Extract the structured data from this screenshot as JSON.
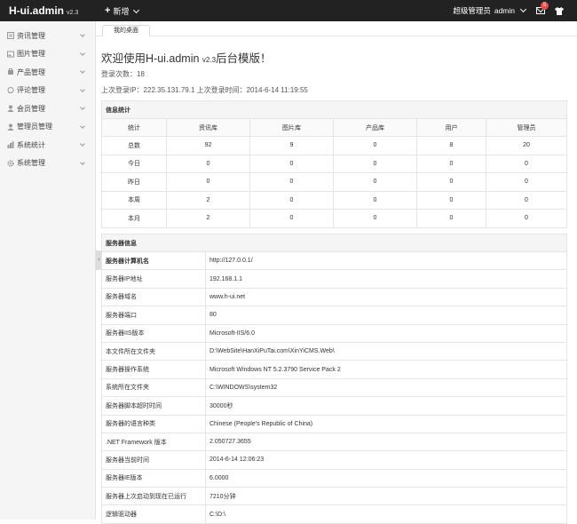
{
  "header": {
    "logo": "H-ui.admin",
    "version": "v2.3",
    "new_label": "新增",
    "role": "超级管理员",
    "user": "admin",
    "msg_count": "5"
  },
  "sidebar": {
    "items": [
      {
        "label": "资讯管理",
        "icon": "news-icon"
      },
      {
        "label": "图片管理",
        "icon": "image-icon"
      },
      {
        "label": "产品管理",
        "icon": "product-icon"
      },
      {
        "label": "评论管理",
        "icon": "comment-icon"
      },
      {
        "label": "会员管理",
        "icon": "member-icon"
      },
      {
        "label": "管理员管理",
        "icon": "admin-icon"
      },
      {
        "label": "系统统计",
        "icon": "stats-icon"
      },
      {
        "label": "系统管理",
        "icon": "system-icon"
      }
    ]
  },
  "tabs": {
    "active": "我的桌面"
  },
  "main": {
    "welcome": "欢迎使用H-ui.admin",
    "welcome_version": "v2.3",
    "welcome_suffix": "后台模版！",
    "login_count": "登录次数：18",
    "last_login": "上次登录IP：222.35.131.79.1  上次登录时间：2014-6-14 11:19:55"
  },
  "stats": {
    "caption": "信息统计",
    "headers": [
      "统计",
      "资讯库",
      "图片库",
      "产品库",
      "用户",
      "管理员"
    ],
    "rows": [
      [
        "总数",
        "92",
        "9",
        "0",
        "8",
        "20"
      ],
      [
        "今日",
        "0",
        "0",
        "0",
        "0",
        "0"
      ],
      [
        "昨日",
        "0",
        "0",
        "0",
        "0",
        "0"
      ],
      [
        "本周",
        "2",
        "0",
        "0",
        "0",
        "0"
      ],
      [
        "本月",
        "2",
        "0",
        "0",
        "0",
        "0"
      ]
    ]
  },
  "server": {
    "caption": "服务器信息",
    "rows": [
      [
        "服务器计算机名",
        "http://127.0.0.1/"
      ],
      [
        "服务器IP地址",
        "192.168.1.1"
      ],
      [
        "服务器域名",
        "www.h-ui.net"
      ],
      [
        "服务器端口",
        "80"
      ],
      [
        "服务器IIS版本",
        "Microsoft-IIS/6.0"
      ],
      [
        "本文件所在文件夹",
        "D:\\WebSite\\HanXiPuTai.com\\XinYiCMS.Web\\"
      ],
      [
        "服务器操作系统",
        "Microsoft Windows NT 5.2.3790 Service Pack 2"
      ],
      [
        "系统所在文件夹",
        "C:\\WINDOWS\\system32"
      ],
      [
        "服务器脚本超时时间",
        "30000秒"
      ],
      [
        "服务器的语言种类",
        "Chinese (People's Republic of China)"
      ],
      [
        ".NET Framework 版本",
        "2.050727.3655"
      ],
      [
        "服务器当前时间",
        "2014-6-14 12:06:23"
      ],
      [
        "服务器IE版本",
        "6.0000"
      ],
      [
        "服务器上次启动到现在已运行",
        "7210分钟"
      ],
      [
        "逻辑驱动器",
        "C:\\D:\\"
      ]
    ]
  }
}
